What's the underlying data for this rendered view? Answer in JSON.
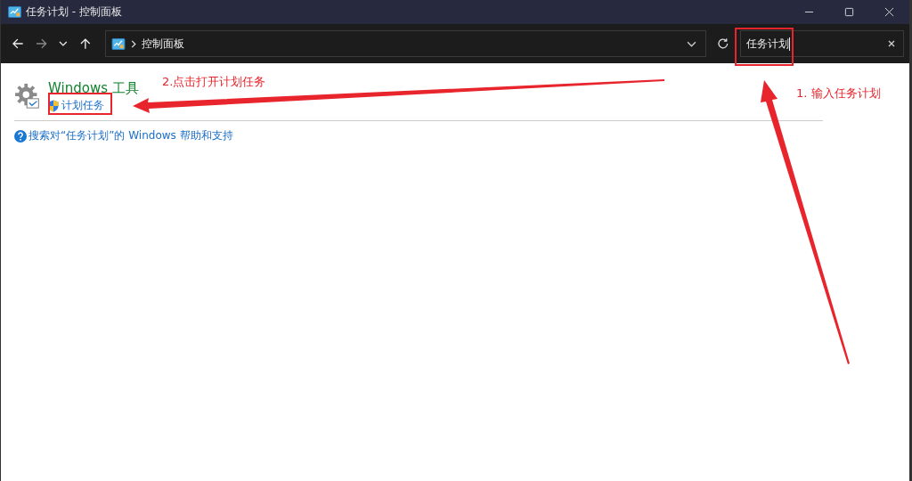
{
  "window": {
    "title": "任务计划 - 控制面板"
  },
  "address_bar": {
    "path": "控制面板"
  },
  "search": {
    "value": "任务计划"
  },
  "results": {
    "title": "Windows 工具",
    "task_link": "计划任务",
    "help_link": "搜索对“任务计划”的 Windows 帮助和支持"
  },
  "annotations": [
    {
      "text": "2.点击打开计划任务"
    },
    {
      "text": "1. 输入任务计划"
    }
  ]
}
